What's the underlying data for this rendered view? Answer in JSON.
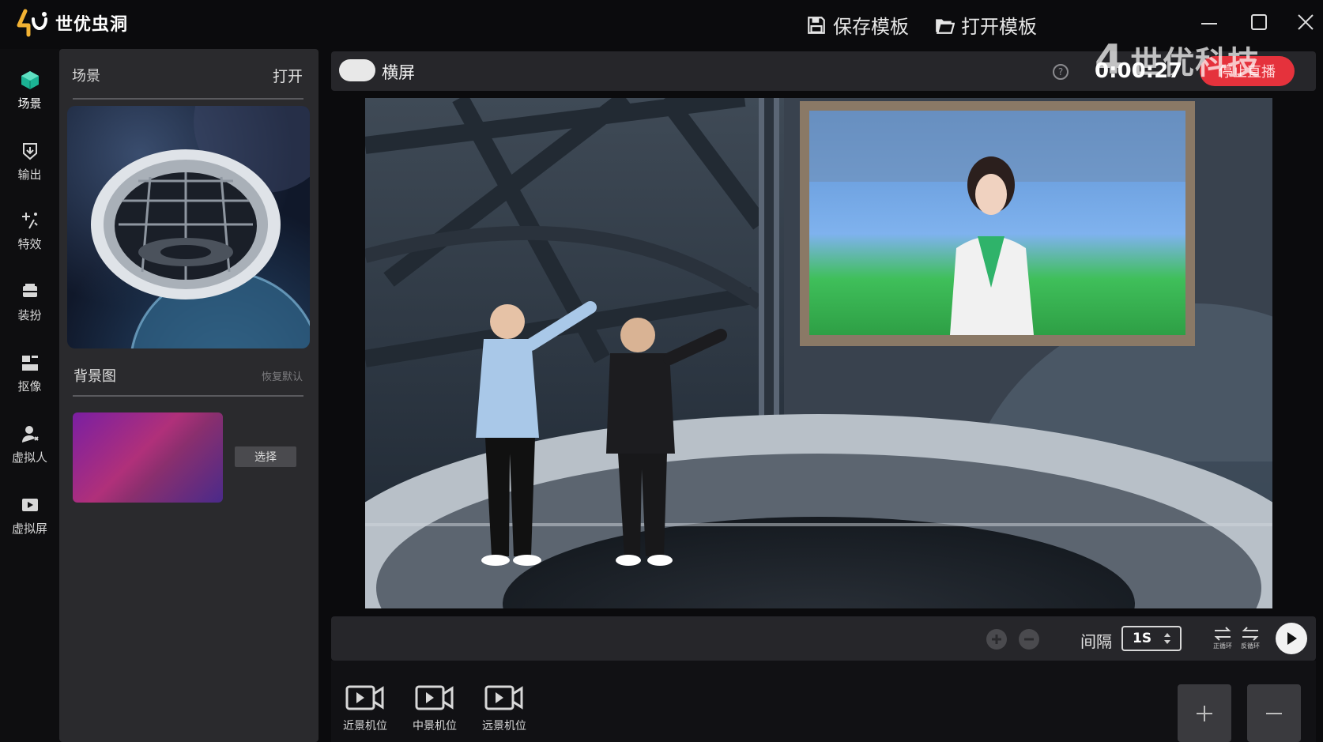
{
  "app": {
    "name": "世优虫洞"
  },
  "toolbar": {
    "save_template": "保存模板",
    "open_template": "打开模板"
  },
  "sidebar": {
    "items": [
      {
        "label": "场景",
        "icon": "cube-icon"
      },
      {
        "label": "输出",
        "icon": "output-icon"
      },
      {
        "label": "特效",
        "icon": "sparkle-icon"
      },
      {
        "label": "装扮",
        "icon": "wardrobe-icon"
      },
      {
        "label": "抠像",
        "icon": "matting-icon"
      },
      {
        "label": "虚拟人",
        "icon": "person-icon"
      },
      {
        "label": "虚拟屏",
        "icon": "screen-icon"
      }
    ]
  },
  "panel": {
    "scene_title": "场景",
    "open_label": "打开",
    "background_title": "背景图",
    "reset_label": "恢复默认",
    "select_label": "选择"
  },
  "preview": {
    "orientation_label": "横屏",
    "help": "?",
    "timer": "0:00:27",
    "stop_label": "停止直播",
    "watermark": "世优科技",
    "watermark_mark": "4"
  },
  "controls": {
    "interval_label": "间隔",
    "interval_value": "1S",
    "forward_loop": "正循环",
    "reverse_loop": "反循环"
  },
  "cameras": [
    {
      "label": "近景机位"
    },
    {
      "label": "中景机位"
    },
    {
      "label": "远景机位"
    }
  ],
  "colors": {
    "accent": "#1bb394",
    "stop": "#e5323c",
    "panel": "#2a2a2d"
  }
}
